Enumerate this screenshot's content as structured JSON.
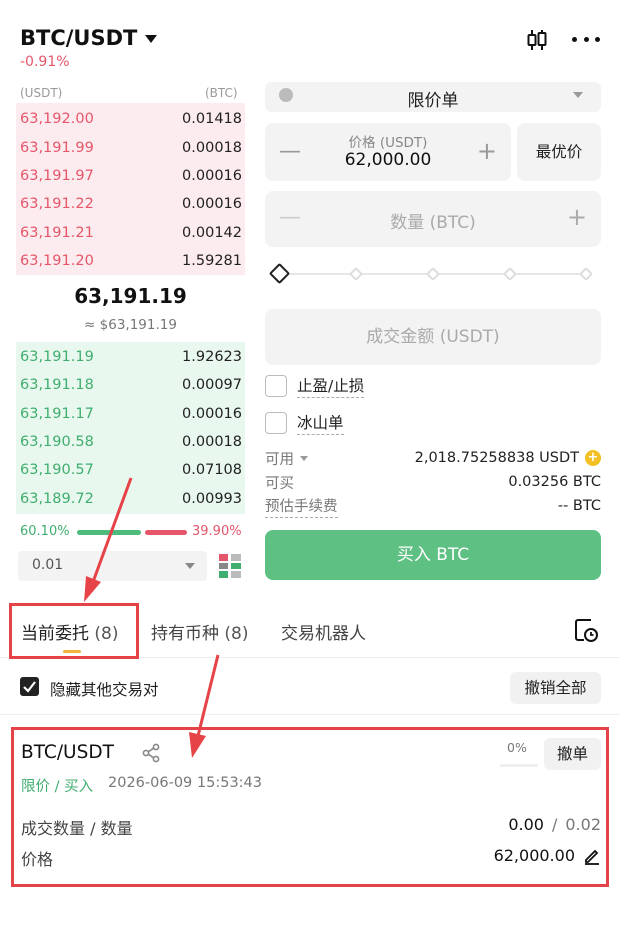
{
  "header": {
    "pair": "BTC/USDT",
    "change": "-0.91%"
  },
  "orderbook": {
    "header_left": "(USDT)",
    "header_right": "(BTC)",
    "asks": [
      {
        "price": "63,192.00",
        "qty": "0.01418"
      },
      {
        "price": "63,191.99",
        "qty": "0.00018"
      },
      {
        "price": "63,191.97",
        "qty": "0.00016"
      },
      {
        "price": "63,191.22",
        "qty": "0.00016"
      },
      {
        "price": "63,191.21",
        "qty": "0.00142"
      },
      {
        "price": "63,191.20",
        "qty": "1.59281"
      }
    ],
    "last_price": "63,191.19",
    "last_price_fiat": "≈ $63,191.19",
    "bids": [
      {
        "price": "63,191.19",
        "qty": "1.92623"
      },
      {
        "price": "63,191.18",
        "qty": "0.00097"
      },
      {
        "price": "63,191.17",
        "qty": "0.00016"
      },
      {
        "price": "63,190.58",
        "qty": "0.00018"
      },
      {
        "price": "63,190.57",
        "qty": "0.07108"
      },
      {
        "price": "63,189.72",
        "qty": "0.00993"
      }
    ],
    "buy_ratio": "60.10%",
    "sell_ratio": "39.90%",
    "depth_value": "0.01"
  },
  "form": {
    "order_type": "限价单",
    "price_label": "价格 (USDT)",
    "price_value": "62,000.00",
    "best_price_button": "最优价",
    "qty_placeholder": "数量 (BTC)",
    "amount_placeholder": "成交金额 (USDT)",
    "tpsl_label": "止盈/止损",
    "iceberg_label": "冰山单",
    "available_label": "可用",
    "available_value": "2,018.75258838 USDT",
    "can_buy_label": "可买",
    "can_buy_value": "0.03256 BTC",
    "fee_label": "预估手续费",
    "fee_value": "-- BTC",
    "buy_button": "买入 BTC"
  },
  "tabs": [
    {
      "label": "当前委托",
      "count": "(8)"
    },
    {
      "label": "持有币种",
      "count": "(8)"
    },
    {
      "label": "交易机器人",
      "count": ""
    }
  ],
  "filter": {
    "hide_other_pairs_label": "隐藏其他交易对",
    "cancel_all_button": "撤销全部"
  },
  "open_order": {
    "pair": "BTC/USDT",
    "fill_percent": "0%",
    "cancel_button": "撤单",
    "type": "限价 / 买入",
    "time": "2026-06-09 15:53:43",
    "filled_label": "成交数量 / 数量",
    "filled_value": "0.00",
    "separator": "/",
    "total_value": "0.02",
    "price_label": "价格",
    "price_value": "62,000.00"
  },
  "colors": {
    "ask": "#e5566a",
    "bid": "#3fae6e",
    "buy_button": "#5fc084",
    "annotation": "#e64348",
    "tab_underline": "#f2b33d"
  }
}
